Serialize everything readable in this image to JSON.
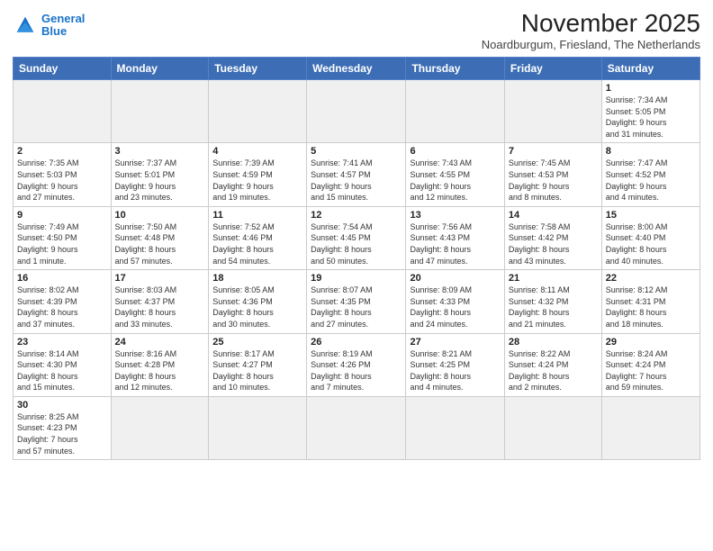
{
  "logo": {
    "line1": "General",
    "line2": "Blue"
  },
  "title": "November 2025",
  "subtitle": "Noardburgum, Friesland, The Netherlands",
  "weekdays": [
    "Sunday",
    "Monday",
    "Tuesday",
    "Wednesday",
    "Thursday",
    "Friday",
    "Saturday"
  ],
  "weeks": [
    [
      {
        "day": "",
        "info": ""
      },
      {
        "day": "",
        "info": ""
      },
      {
        "day": "",
        "info": ""
      },
      {
        "day": "",
        "info": ""
      },
      {
        "day": "",
        "info": ""
      },
      {
        "day": "",
        "info": ""
      },
      {
        "day": "1",
        "info": "Sunrise: 7:34 AM\nSunset: 5:05 PM\nDaylight: 9 hours\nand 31 minutes."
      }
    ],
    [
      {
        "day": "2",
        "info": "Sunrise: 7:35 AM\nSunset: 5:03 PM\nDaylight: 9 hours\nand 27 minutes."
      },
      {
        "day": "3",
        "info": "Sunrise: 7:37 AM\nSunset: 5:01 PM\nDaylight: 9 hours\nand 23 minutes."
      },
      {
        "day": "4",
        "info": "Sunrise: 7:39 AM\nSunset: 4:59 PM\nDaylight: 9 hours\nand 19 minutes."
      },
      {
        "day": "5",
        "info": "Sunrise: 7:41 AM\nSunset: 4:57 PM\nDaylight: 9 hours\nand 15 minutes."
      },
      {
        "day": "6",
        "info": "Sunrise: 7:43 AM\nSunset: 4:55 PM\nDaylight: 9 hours\nand 12 minutes."
      },
      {
        "day": "7",
        "info": "Sunrise: 7:45 AM\nSunset: 4:53 PM\nDaylight: 9 hours\nand 8 minutes."
      },
      {
        "day": "8",
        "info": "Sunrise: 7:47 AM\nSunset: 4:52 PM\nDaylight: 9 hours\nand 4 minutes."
      }
    ],
    [
      {
        "day": "9",
        "info": "Sunrise: 7:49 AM\nSunset: 4:50 PM\nDaylight: 9 hours\nand 1 minute."
      },
      {
        "day": "10",
        "info": "Sunrise: 7:50 AM\nSunset: 4:48 PM\nDaylight: 8 hours\nand 57 minutes."
      },
      {
        "day": "11",
        "info": "Sunrise: 7:52 AM\nSunset: 4:46 PM\nDaylight: 8 hours\nand 54 minutes."
      },
      {
        "day": "12",
        "info": "Sunrise: 7:54 AM\nSunset: 4:45 PM\nDaylight: 8 hours\nand 50 minutes."
      },
      {
        "day": "13",
        "info": "Sunrise: 7:56 AM\nSunset: 4:43 PM\nDaylight: 8 hours\nand 47 minutes."
      },
      {
        "day": "14",
        "info": "Sunrise: 7:58 AM\nSunset: 4:42 PM\nDaylight: 8 hours\nand 43 minutes."
      },
      {
        "day": "15",
        "info": "Sunrise: 8:00 AM\nSunset: 4:40 PM\nDaylight: 8 hours\nand 40 minutes."
      }
    ],
    [
      {
        "day": "16",
        "info": "Sunrise: 8:02 AM\nSunset: 4:39 PM\nDaylight: 8 hours\nand 37 minutes."
      },
      {
        "day": "17",
        "info": "Sunrise: 8:03 AM\nSunset: 4:37 PM\nDaylight: 8 hours\nand 33 minutes."
      },
      {
        "day": "18",
        "info": "Sunrise: 8:05 AM\nSunset: 4:36 PM\nDaylight: 8 hours\nand 30 minutes."
      },
      {
        "day": "19",
        "info": "Sunrise: 8:07 AM\nSunset: 4:35 PM\nDaylight: 8 hours\nand 27 minutes."
      },
      {
        "day": "20",
        "info": "Sunrise: 8:09 AM\nSunset: 4:33 PM\nDaylight: 8 hours\nand 24 minutes."
      },
      {
        "day": "21",
        "info": "Sunrise: 8:11 AM\nSunset: 4:32 PM\nDaylight: 8 hours\nand 21 minutes."
      },
      {
        "day": "22",
        "info": "Sunrise: 8:12 AM\nSunset: 4:31 PM\nDaylight: 8 hours\nand 18 minutes."
      }
    ],
    [
      {
        "day": "23",
        "info": "Sunrise: 8:14 AM\nSunset: 4:30 PM\nDaylight: 8 hours\nand 15 minutes."
      },
      {
        "day": "24",
        "info": "Sunrise: 8:16 AM\nSunset: 4:28 PM\nDaylight: 8 hours\nand 12 minutes."
      },
      {
        "day": "25",
        "info": "Sunrise: 8:17 AM\nSunset: 4:27 PM\nDaylight: 8 hours\nand 10 minutes."
      },
      {
        "day": "26",
        "info": "Sunrise: 8:19 AM\nSunset: 4:26 PM\nDaylight: 8 hours\nand 7 minutes."
      },
      {
        "day": "27",
        "info": "Sunrise: 8:21 AM\nSunset: 4:25 PM\nDaylight: 8 hours\nand 4 minutes."
      },
      {
        "day": "28",
        "info": "Sunrise: 8:22 AM\nSunset: 4:24 PM\nDaylight: 8 hours\nand 2 minutes."
      },
      {
        "day": "29",
        "info": "Sunrise: 8:24 AM\nSunset: 4:24 PM\nDaylight: 7 hours\nand 59 minutes."
      }
    ],
    [
      {
        "day": "30",
        "info": "Sunrise: 8:25 AM\nSunset: 4:23 PM\nDaylight: 7 hours\nand 57 minutes."
      },
      {
        "day": "",
        "info": ""
      },
      {
        "day": "",
        "info": ""
      },
      {
        "day": "",
        "info": ""
      },
      {
        "day": "",
        "info": ""
      },
      {
        "day": "",
        "info": ""
      },
      {
        "day": "",
        "info": ""
      }
    ]
  ]
}
